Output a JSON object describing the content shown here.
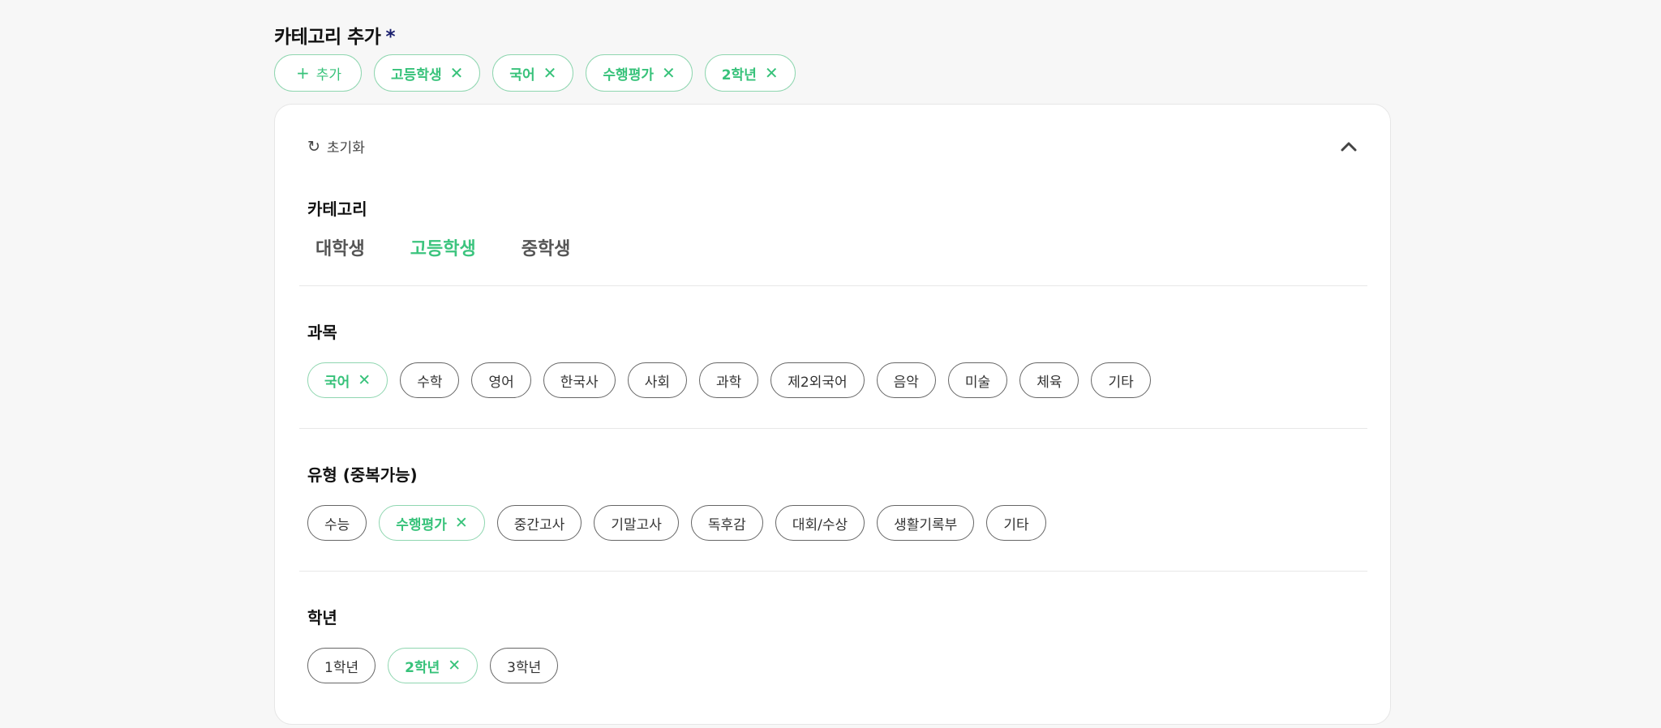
{
  "header": {
    "label": "카테고리 추가",
    "required_mark": "*"
  },
  "selected": {
    "add_label": "추가",
    "items": [
      "고등학생",
      "국어",
      "수행평가",
      "2학년"
    ]
  },
  "panel": {
    "reset_label": "초기화",
    "category": {
      "title": "카테고리",
      "tabs": [
        "대학생",
        "고등학생",
        "중학생"
      ],
      "active_tab": "고등학생"
    },
    "subject": {
      "title": "과목",
      "options": [
        "국어",
        "수학",
        "영어",
        "한국사",
        "사회",
        "과학",
        "제2외국어",
        "음악",
        "미술",
        "체육",
        "기타"
      ],
      "selected": [
        "국어"
      ]
    },
    "type": {
      "title": "유형 (중복가능)",
      "options": [
        "수능",
        "수행평가",
        "중간고사",
        "기말고사",
        "독후감",
        "대회/수상",
        "생활기록부",
        "기타"
      ],
      "selected": [
        "수행평가"
      ]
    },
    "grade": {
      "title": "학년",
      "options": [
        "1학년",
        "2학년",
        "3학년"
      ],
      "selected": [
        "2학년"
      ]
    }
  },
  "colors": {
    "accent": "#3cc47e",
    "accent_border": "#8fd6b0",
    "required": "#1a1f6e"
  },
  "icons": {
    "add": "plus-icon",
    "remove": "close-icon",
    "reset": "refresh-icon",
    "collapse": "chevron-up-icon"
  }
}
